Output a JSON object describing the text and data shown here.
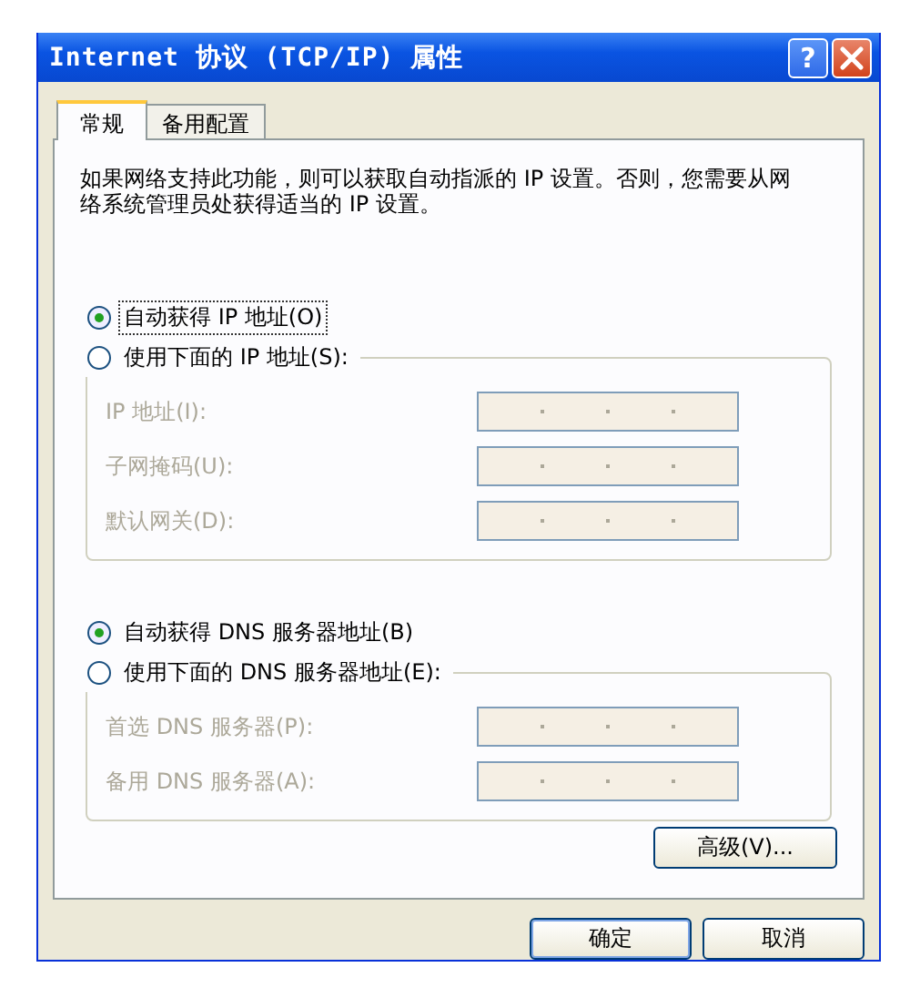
{
  "window": {
    "title": "Internet 协议 (TCP/IP) 属性",
    "help": "?"
  },
  "tabs": [
    {
      "label": "常规",
      "selected": true
    },
    {
      "label": "备用配置",
      "selected": false
    }
  ],
  "description": "如果网络支持此功能，则可以获取自动指派的 IP 设置。否则，您需要从网络系统管理员处获得适当的 IP 设置。",
  "sections": [
    {
      "options": [
        {
          "label": "自动获得 IP 地址(O)",
          "selected": true,
          "focused": true
        },
        {
          "label": "使用下面的 IP 地址(S):",
          "selected": false,
          "focused": false
        }
      ],
      "fields": [
        {
          "label": "IP 地址(I):",
          "disabled": true
        },
        {
          "label": "子网掩码(U):",
          "disabled": true
        },
        {
          "label": "默认网关(D):",
          "disabled": true
        }
      ]
    },
    {
      "options": [
        {
          "label": "自动获得 DNS 服务器地址(B)",
          "selected": true,
          "focused": false
        },
        {
          "label": "使用下面的 DNS 服务器地址(E):",
          "selected": false,
          "focused": false
        }
      ],
      "fields": [
        {
          "label": "首选 DNS 服务器(P):",
          "disabled": true
        },
        {
          "label": "备用 DNS 服务器(A):",
          "disabled": true
        }
      ]
    }
  ],
  "advanced_button": "高级(V)...",
  "buttons": [
    "确定",
    "取消"
  ]
}
